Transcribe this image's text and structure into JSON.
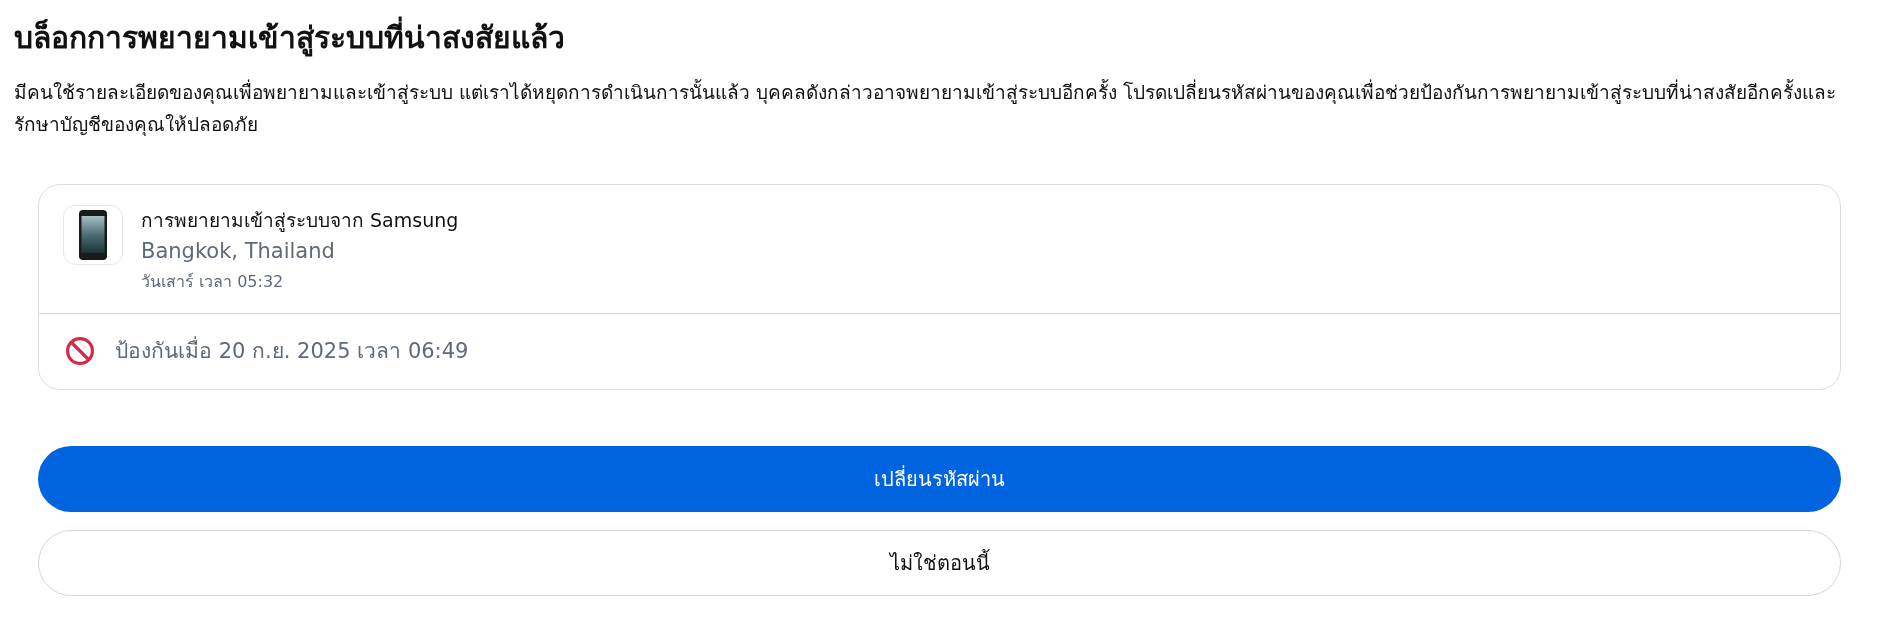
{
  "title": "บล็อกการพยายามเข้าสู่ระบบที่น่าสงสัยแล้ว",
  "description": "มีคนใช้รายละเอียดของคุณเพื่อพยายามและเข้าสู่ระบบ แต่เราได้หยุดการดำเนินการนั้นแล้ว บุคคลดังกล่าวอาจพยายามเข้าสู่ระบบอีกครั้ง โปรดเปลี่ยนรหัสผ่านของคุณเพื่อช่วยป้องกันการพยายามเข้าสู่ระบบที่น่าสงสัยอีกครั้งและรักษาบัญชีของคุณให้ปลอดภัย",
  "login_attempt": {
    "heading": "การพยายามเข้าสู่ระบบจาก Samsung",
    "location": "Bangkok, Thailand",
    "time": "วันเสาร์ เวลา 05:32",
    "blocked": "ป้องกันเมื่อ 20 ก.ย. 2025 เวลา 06:49"
  },
  "buttons": [
    {
      "label": "เปลี่ยนรหัสผ่าน",
      "kind": "primary"
    },
    {
      "label": "ไม่ใช่ตอนนี้",
      "kind": "secondary"
    }
  ]
}
